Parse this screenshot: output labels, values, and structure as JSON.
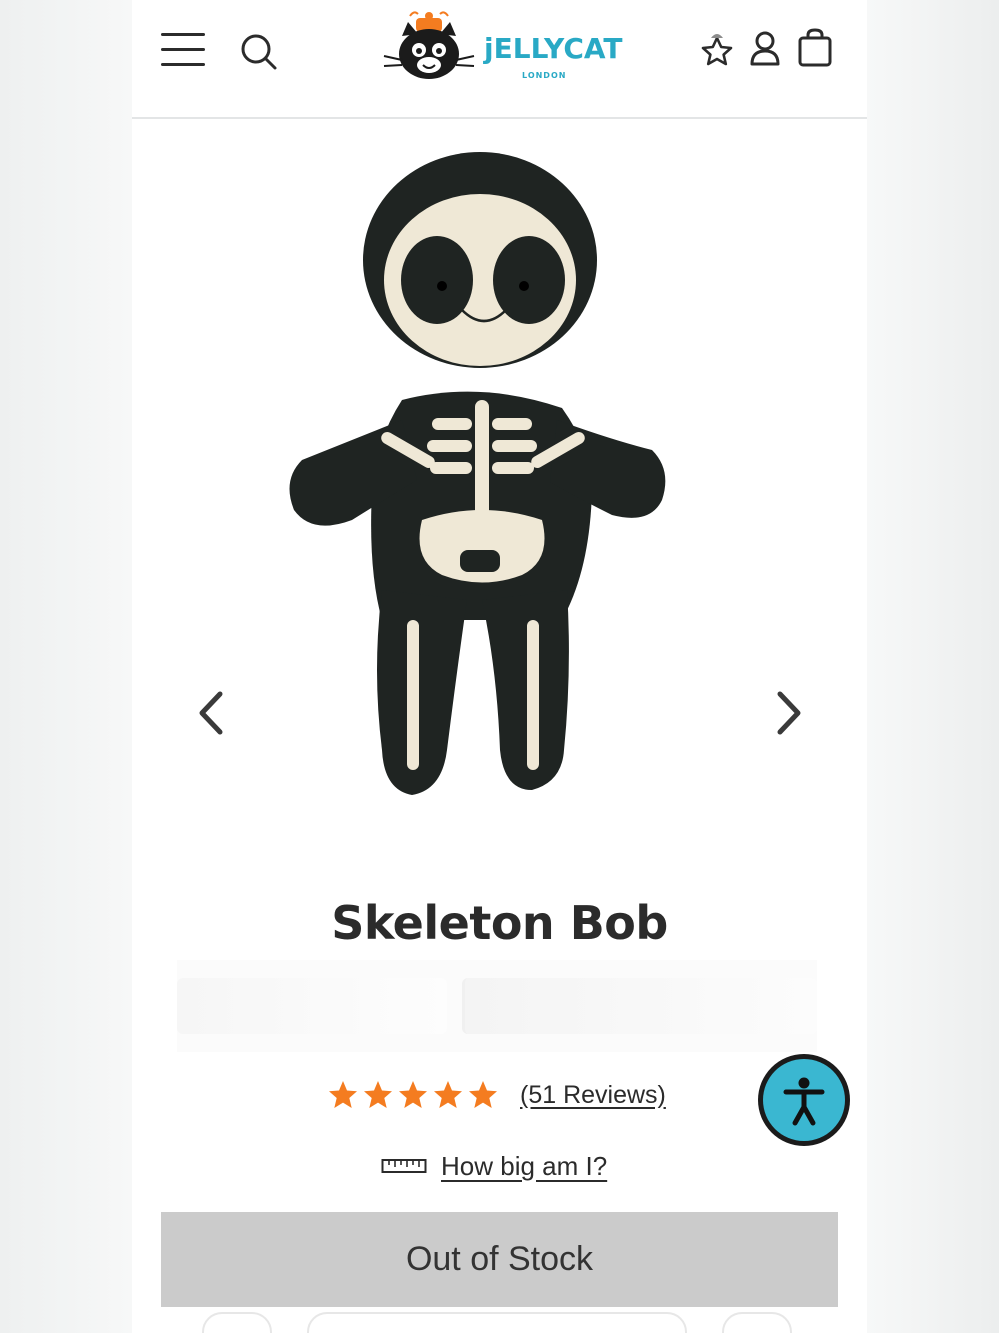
{
  "header": {
    "brand_name": "jELLYCAT",
    "brand_sub": "LONDON",
    "icons": [
      "menu-icon",
      "search-icon",
      "wishlist-star-icon",
      "account-icon",
      "shopping-bag-icon"
    ]
  },
  "product": {
    "title": "Skeleton Bob",
    "image_icon": "skeleton-plush-image",
    "rating": 5,
    "rating_max": 5,
    "reviews_label": "(51 Reviews)",
    "size_guide_label": "How big am I?",
    "stock_button_label": "Out of Stock"
  },
  "colors": {
    "brand": "#29a9c5",
    "star": "#f47c20",
    "button_disabled": "#cbcbcb",
    "accessibility": "#3ab7d1"
  }
}
